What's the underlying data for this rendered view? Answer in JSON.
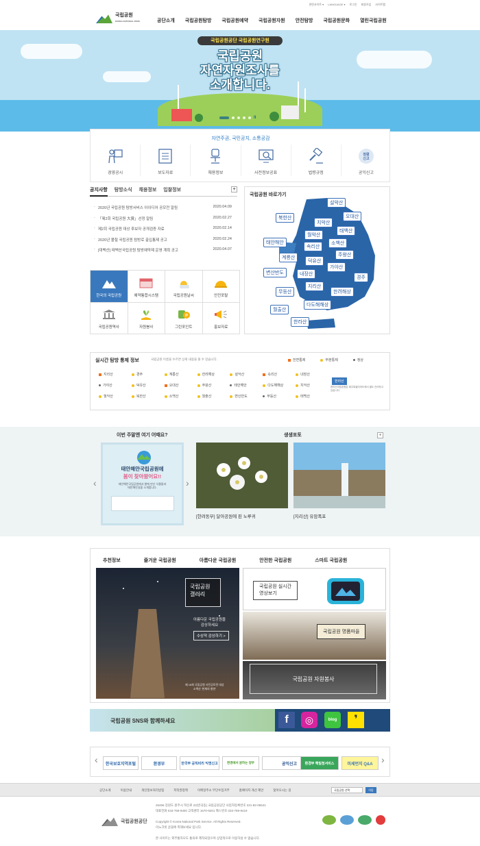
{
  "util": {
    "links": [
      "관련사이트 ▾",
      "LANGUAGE ▾",
      "로그인",
      "회원가입",
      "사이트맵"
    ]
  },
  "logo": {
    "name": "국립공원",
    "sub": "KOREA NATIONAL PARK"
  },
  "gnb": [
    "공단소개",
    "국립공원탐방",
    "국립공원예약",
    "국립공원자원",
    "안전탐방",
    "국립공원문화",
    "열린국립공원"
  ],
  "hero": {
    "badge": "국립공원공단 국립공원연구원",
    "title_lines": [
      "국립공원",
      "자연자원조사를",
      "소개합니다."
    ],
    "pause": "II"
  },
  "quick": {
    "title": "자연주권, 국민공치, 소통공감",
    "items": [
      "경영공시",
      "보도자료",
      "채용정보",
      "사전정보공표",
      "법령규정",
      "공익신고"
    ]
  },
  "notice": {
    "tabs": [
      "공지사항",
      "탐방소식",
      "채용정보",
      "입찰정보"
    ],
    "plus": "+",
    "items": [
      {
        "title": "2020년 국립공원 탐방서비스 아이디어 공모전 알림",
        "date": "2020.04.09"
      },
      {
        "title": "「제2회 국립공원 大賞」선정 알림",
        "date": "2020.02.27"
      },
      {
        "title": "제2회 국립공원 대상 후보자 공개검증 자료",
        "date": "2020.02.14"
      },
      {
        "title": "2020년 볼철 국립공원 탐방로 출입통제 공고",
        "date": "2020.02.24"
      },
      {
        "title": "[대백산] 태백산국립공원 탐방예약제 운영 계획 공고",
        "date": "2020.04.07"
      }
    ]
  },
  "services": [
    "한국의 국립공원",
    "예약통합시스템",
    "국립공원날씨",
    "안전포탈",
    "국립공원역사",
    "자원봉사",
    "그린포인트",
    "홍보자료"
  ],
  "map": {
    "title": "국립공원 바로가기",
    "parks": [
      "설악산",
      "오대산",
      "북한산",
      "치악산",
      "태백산",
      "월악산",
      "소백산",
      "태안해안",
      "속리산",
      "주왕산",
      "계룡산",
      "덕유산",
      "가야산",
      "변산반도",
      "내장산",
      "경주",
      "지리산",
      "한려해상",
      "무등산",
      "다도해해상",
      "월출산",
      "한라산"
    ]
  },
  "control": {
    "title": "실시간 탐방 통제 정보",
    "desc": "국립공원 이름을 누르면 상세 내용을 볼 수 있습니다.",
    "legend": [
      "전면통제",
      "부분통제",
      "정상"
    ],
    "parks": [
      [
        "지리산",
        "sq"
      ],
      [
        "경주",
        "ci"
      ],
      [
        "계룡산",
        "ci"
      ],
      [
        "한려해상",
        "ci"
      ],
      [
        "설악산",
        "ci"
      ],
      [
        "속리산",
        "sq"
      ],
      [
        "내장산",
        "ci"
      ],
      [
        "가야산",
        "dt"
      ],
      [
        "덕유산",
        "ci"
      ],
      [
        "오대산",
        "sq"
      ],
      [
        "주왕산",
        "ci"
      ],
      [
        "태안해안",
        "dt"
      ],
      [
        "다도해해상",
        "ci"
      ],
      [
        "치악산",
        "ci"
      ],
      [
        "월악산",
        "ci"
      ],
      [
        "북한산",
        "ci"
      ],
      [
        "소백산",
        "ci"
      ],
      [
        "월출산",
        "ci"
      ],
      [
        "변산반도",
        "ci"
      ],
      [
        "무등산",
        "dt"
      ],
      [
        "태백산",
        "ci"
      ]
    ],
    "hallasan": "한라산",
    "hallasan_desc": "한라산국립공원은 제주특별자치도에서 별도 관리하고 있습니다."
  },
  "weekend": {
    "title": "이번 주말엔 여기 어때요?",
    "ad_head": [
      "태안해안국립공원에",
      "봄이 찾아왔어요!!"
    ],
    "ad_sub": [
      "태안해안국립공원에서 봄에 만난 식물들과",
      "태안해안길을 소개합니다."
    ]
  },
  "photos": {
    "title": "생생포토",
    "plus": "+",
    "items": [
      "[한려동부] 달아공원에 핀 노루귀",
      "[지리산] 유암폭포"
    ]
  },
  "reco": {
    "tabs": [
      "추천정보",
      "즐거운 국립공원",
      "아름다운 국립공원",
      "안전한 국립공원",
      "스마트 국립공원"
    ],
    "gallery_title": [
      "국립공원",
      "갤러리"
    ],
    "gallery_text": [
      "아름다운 국립공원을",
      "감상하세요"
    ],
    "gallery_btn": "수상작 감상하기 >",
    "gallery_caption": [
      "제 18회 국립공원 사진공모전 대상",
      "소백산 '천체의 향연'"
    ],
    "live": [
      "국립공원 실시간",
      "영상보기"
    ],
    "village": "국립공원 명품마을",
    "resource": "국립공원 자원봉사"
  },
  "sns": {
    "title": "국립공원 SNS와 함께하세요",
    "icons": [
      "f",
      "◎",
      "blog",
      "❜"
    ]
  },
  "family": [
    "한국보호지역포털",
    "환경부",
    "한국부 공직비리 익명신고",
    "환경에서 원하는 정부",
    "공익신고",
    "환경부 헤밀청서비스",
    "미세먼지 Q&A"
  ],
  "footer": {
    "links": [
      "공단소개",
      "이용안내",
      "개인정보처리방침",
      "저작권정책",
      "이메일주소 무단수집거부",
      "홈페이지 개선 제안",
      "찾아오시는 길"
    ],
    "select": "국립공원 선택",
    "go": "이동",
    "info": [
      "26466 강원도 원주시 혁신로 22(반곡동) 국립공원공단    사업자등록번호 221-82-06541",
      "대표전화 033-769-9300      고객센터 1670-9201    팩스번호 033-769-9419",
      "",
      "Copyright © Korea National Park Service. All Rights Reserved.",
      "이노크빗 글꼴에 취해보세요 입니다.",
      "",
      "본 사이트는 외부통하모도 통의로 제작되었으며 상업적으로 이용하실 수 없습니다."
    ],
    "logo": "국립공원공단"
  }
}
